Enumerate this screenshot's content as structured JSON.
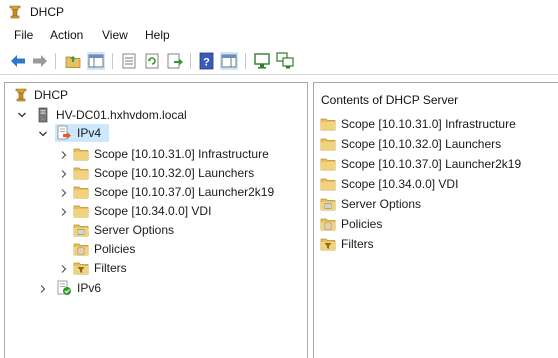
{
  "window": {
    "title": "DHCP",
    "icon": "dhcp-server-icon"
  },
  "menu": [
    "File",
    "Action",
    "View",
    "Help"
  ],
  "toolbar": {
    "buttons": [
      "back-arrow-icon",
      "forward-arrow-icon",
      "up-folder-icon",
      "show-hide-console-tree-icon",
      "properties-icon",
      "refresh-icon",
      "export-list-icon",
      "help-icon",
      "show-action-pane-icon",
      "monitor-icon",
      "monitor-network-icon"
    ]
  },
  "tree": {
    "root": "DHCP",
    "server": "HV-DC01.hxhvdom.local",
    "ipv4": "IPv4",
    "scopes": [
      "Scope [10.10.31.0] Infrastructure",
      "Scope [10.10.32.0] Launchers",
      "Scope [10.10.37.0] Launcher2k19",
      "Scope [10.34.0.0] VDI"
    ],
    "server_options": "Server Options",
    "policies": "Policies",
    "filters": "Filters",
    "ipv6": "IPv6"
  },
  "contents": {
    "header": "Contents of DHCP Server",
    "items": [
      {
        "label": "Scope [10.10.31.0] Infrastructure",
        "icon": "folder-icon"
      },
      {
        "label": "Scope [10.10.32.0] Launchers",
        "icon": "folder-icon"
      },
      {
        "label": "Scope [10.10.37.0] Launcher2k19",
        "icon": "folder-icon"
      },
      {
        "label": "Scope [10.34.0.0] VDI",
        "icon": "folder-icon"
      },
      {
        "label": "Server Options",
        "icon": "server-options-icon"
      },
      {
        "label": "Policies",
        "icon": "policies-icon"
      },
      {
        "label": "Filters",
        "icon": "filters-icon"
      }
    ]
  },
  "colors": {
    "selection": "#cce8ff",
    "folder": "#e8c064",
    "arrow": "#2d78c8"
  }
}
